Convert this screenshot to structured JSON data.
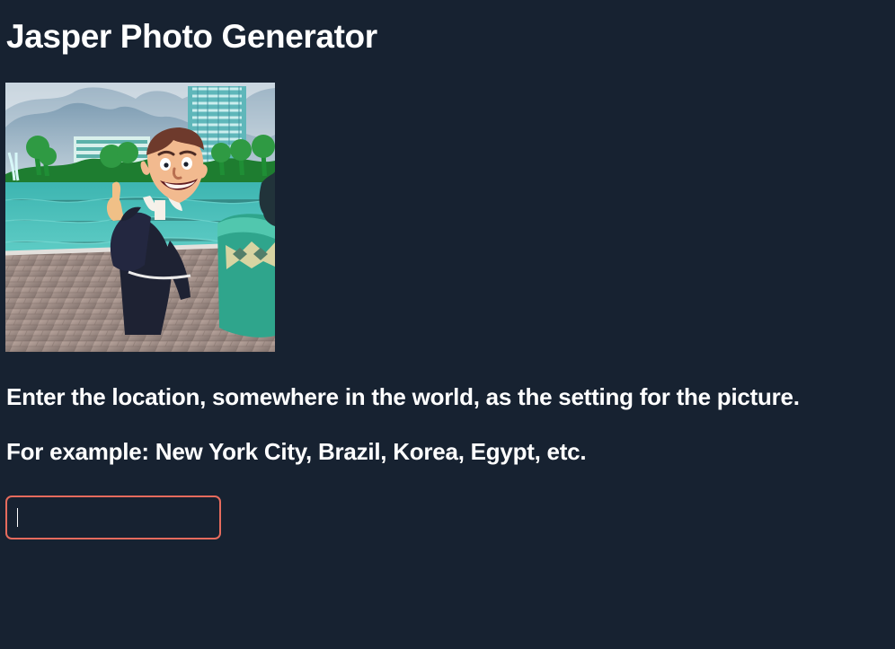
{
  "app": {
    "title": "Jasper Photo Generator"
  },
  "hero_image": {
    "subject": "Mascot character in black clerical outfit pointing upward by waterfront"
  },
  "instructions": {
    "line1": "Enter the location, somewhere in the world, as the setting for the picture.",
    "line2": "For example: New York City, Brazil, Korea, Egypt, etc."
  },
  "location_input": {
    "value": "",
    "placeholder": ""
  },
  "colors": {
    "background": "#172231",
    "text": "#ffffff",
    "input_focus_border": "#e66b5d"
  }
}
